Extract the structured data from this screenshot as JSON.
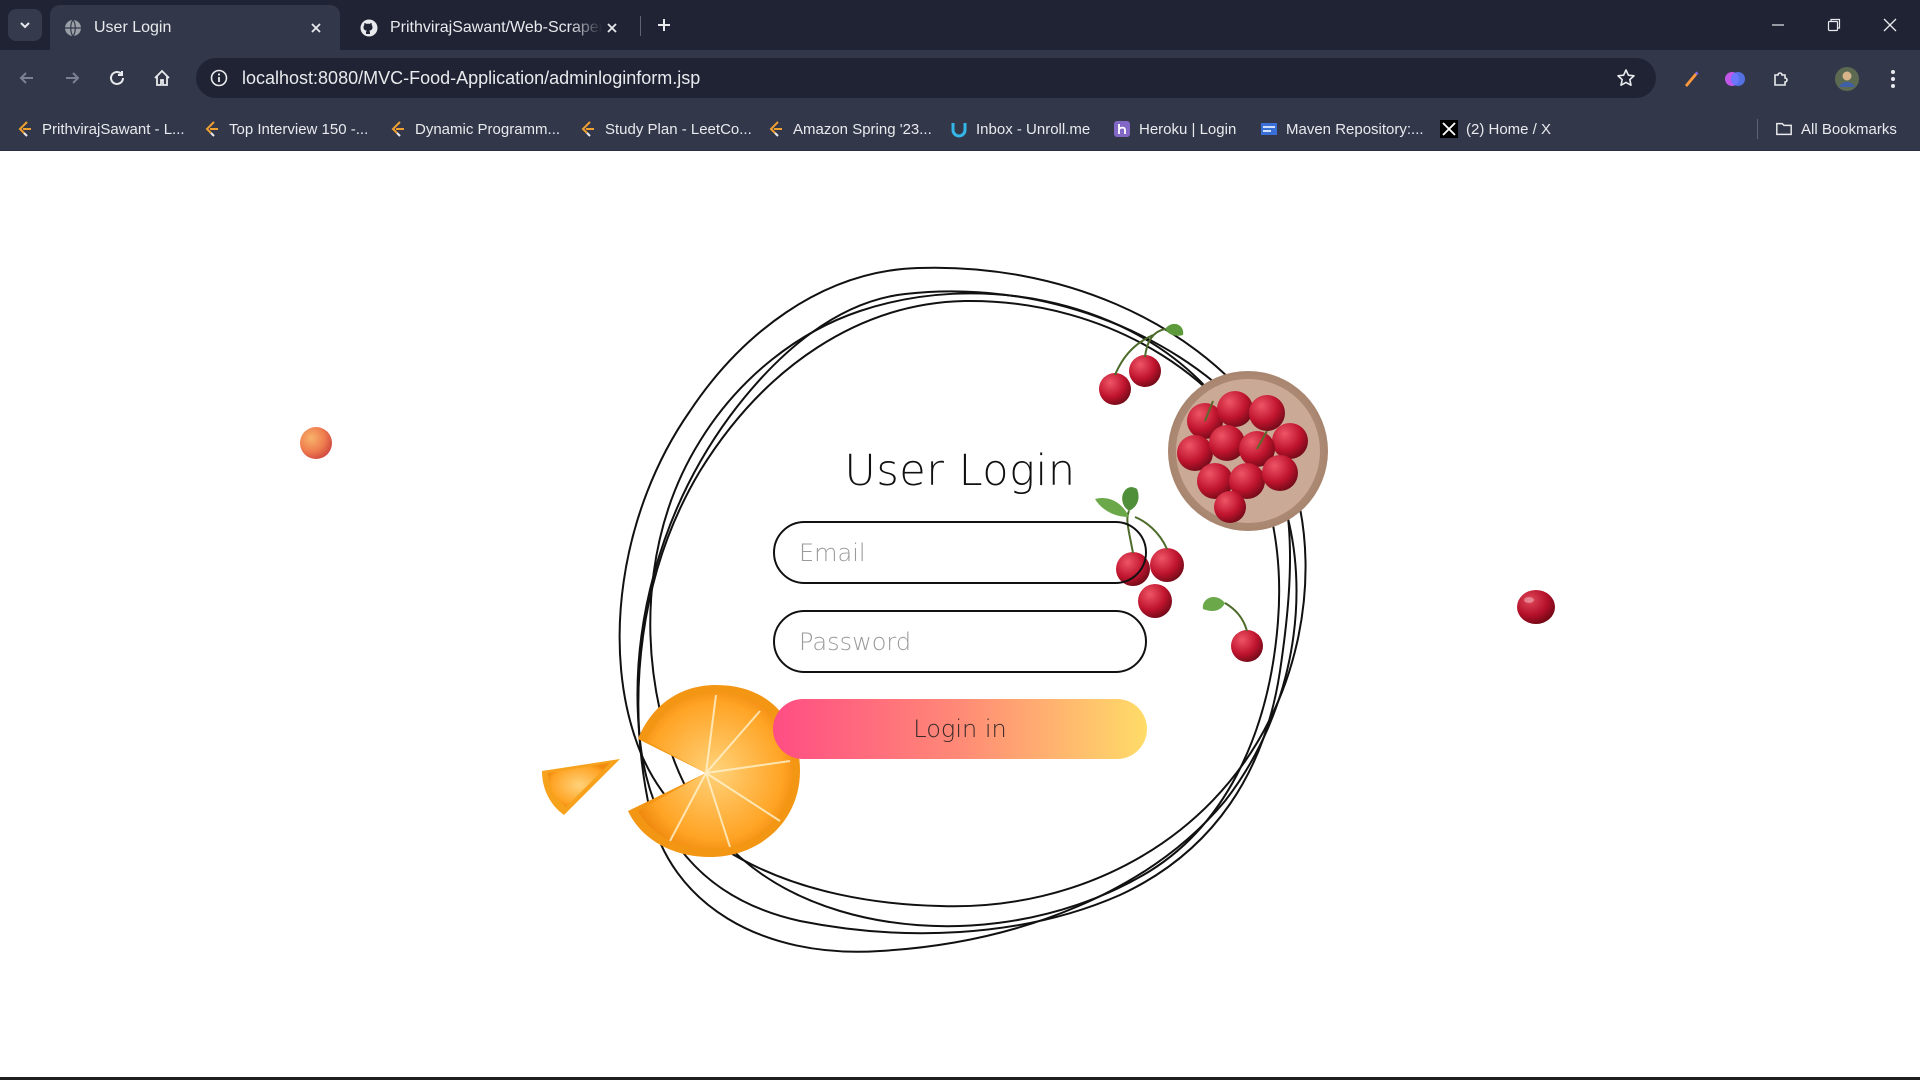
{
  "browser": {
    "tabs": [
      {
        "title": "User Login",
        "active": true,
        "icon": "globe-icon"
      },
      {
        "title": "PrithvirajSawant/Web-Scraper: A",
        "active": false,
        "icon": "github-icon"
      }
    ],
    "url": "localhost:8080/MVC-Food-Application/adminloginform.jsp",
    "bookmarks": [
      {
        "label": "PrithvirajSawant - L...",
        "icon": "leetcode-icon"
      },
      {
        "label": "Top Interview 150 -...",
        "icon": "leetcode-icon"
      },
      {
        "label": "Dynamic Programm...",
        "icon": "leetcode-icon"
      },
      {
        "label": "Study Plan - LeetCo...",
        "icon": "leetcode-icon"
      },
      {
        "label": "Amazon Spring '23...",
        "icon": "leetcode-icon"
      },
      {
        "label": "Inbox - Unroll.me",
        "icon": "unroll-icon"
      },
      {
        "label": "Heroku | Login",
        "icon": "heroku-icon"
      },
      {
        "label": "Maven Repository:...",
        "icon": "maven-icon"
      },
      {
        "label": "(2) Home / X",
        "icon": "x-icon"
      }
    ],
    "all_bookmarks_label": "All Bookmarks"
  },
  "login": {
    "title": "User Login",
    "email_placeholder": "Email",
    "password_placeholder": "Password",
    "submit_label": "Login in"
  },
  "colors": {
    "chrome_dark": "#202334",
    "chrome_toolbar": "#33374a",
    "button_gradient_start": "#ff4d84",
    "button_gradient_end": "#ffdc68"
  }
}
